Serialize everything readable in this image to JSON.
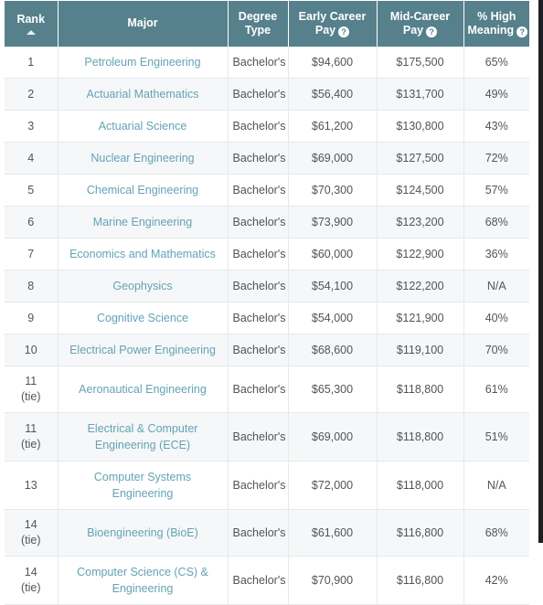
{
  "table": {
    "columns": [
      {
        "key": "rank",
        "label": "Rank",
        "label_line2": "",
        "help": false,
        "sort": "ascending"
      },
      {
        "key": "major",
        "label": "Major",
        "label_line2": "",
        "help": false,
        "sort": "none"
      },
      {
        "key": "degree",
        "label": "Degree",
        "label_line2": "Type",
        "help": false,
        "sort": "none"
      },
      {
        "key": "early",
        "label": "Early Career",
        "label_line2": "Pay",
        "help": true,
        "sort": "none"
      },
      {
        "key": "mid",
        "label": "Mid-Career",
        "label_line2": "Pay",
        "help": true,
        "sort": "none"
      },
      {
        "key": "meaning",
        "label": "% High",
        "label_line2": "Meaning",
        "help": true,
        "sort": "none"
      }
    ],
    "help_icon_glyph": "?",
    "sort_caret_icon": "caret-up-icon",
    "rows": [
      {
        "rank": "1",
        "tie": "",
        "major": "Petroleum Engineering",
        "degree": "Bachelor's",
        "early": "$94,600",
        "mid": "$175,500",
        "meaning": "65%"
      },
      {
        "rank": "2",
        "tie": "",
        "major": "Actuarial Mathematics",
        "degree": "Bachelor's",
        "early": "$56,400",
        "mid": "$131,700",
        "meaning": "49%"
      },
      {
        "rank": "3",
        "tie": "",
        "major": "Actuarial Science",
        "degree": "Bachelor's",
        "early": "$61,200",
        "mid": "$130,800",
        "meaning": "43%"
      },
      {
        "rank": "4",
        "tie": "",
        "major": "Nuclear Engineering",
        "degree": "Bachelor's",
        "early": "$69,000",
        "mid": "$127,500",
        "meaning": "72%"
      },
      {
        "rank": "5",
        "tie": "",
        "major": "Chemical Engineering",
        "degree": "Bachelor's",
        "early": "$70,300",
        "mid": "$124,500",
        "meaning": "57%"
      },
      {
        "rank": "6",
        "tie": "",
        "major": "Marine Engineering",
        "degree": "Bachelor's",
        "early": "$73,900",
        "mid": "$123,200",
        "meaning": "68%"
      },
      {
        "rank": "7",
        "tie": "",
        "major": "Economics and Mathematics",
        "degree": "Bachelor's",
        "early": "$60,000",
        "mid": "$122,900",
        "meaning": "36%"
      },
      {
        "rank": "8",
        "tie": "",
        "major": "Geophysics",
        "degree": "Bachelor's",
        "early": "$54,100",
        "mid": "$122,200",
        "meaning": "N/A"
      },
      {
        "rank": "9",
        "tie": "",
        "major": "Cognitive Science",
        "degree": "Bachelor's",
        "early": "$54,000",
        "mid": "$121,900",
        "meaning": "40%"
      },
      {
        "rank": "10",
        "tie": "",
        "major": "Electrical Power Engineering",
        "degree": "Bachelor's",
        "early": "$68,600",
        "mid": "$119,100",
        "meaning": "70%"
      },
      {
        "rank": "11",
        "tie": "(tie)",
        "major": "Aeronautical Engineering",
        "degree": "Bachelor's",
        "early": "$65,300",
        "mid": "$118,800",
        "meaning": "61%"
      },
      {
        "rank": "11",
        "tie": "(tie)",
        "major": "Electrical & Computer Engineering (ECE)",
        "degree": "Bachelor's",
        "early": "$69,000",
        "mid": "$118,800",
        "meaning": "51%"
      },
      {
        "rank": "13",
        "tie": "",
        "major": "Computer Systems Engineering",
        "degree": "Bachelor's",
        "early": "$72,000",
        "mid": "$118,000",
        "meaning": "N/A"
      },
      {
        "rank": "14",
        "tie": "(tie)",
        "major": "Bioengineering (BioE)",
        "degree": "Bachelor's",
        "early": "$61,600",
        "mid": "$116,800",
        "meaning": "68%"
      },
      {
        "rank": "14",
        "tie": "(tie)",
        "major": "Computer Science (CS) & Engineering",
        "degree": "Bachelor's",
        "early": "$70,900",
        "mid": "$116,800",
        "meaning": "42%"
      }
    ]
  },
  "colors": {
    "header_background": "#56808b",
    "header_text": "#ffffff",
    "link_text": "#64a3b5",
    "body_text": "#4f5559",
    "row_alt_background": "#f6f7f8",
    "row_background": "#ffffff",
    "border": "#e6e8ea"
  }
}
